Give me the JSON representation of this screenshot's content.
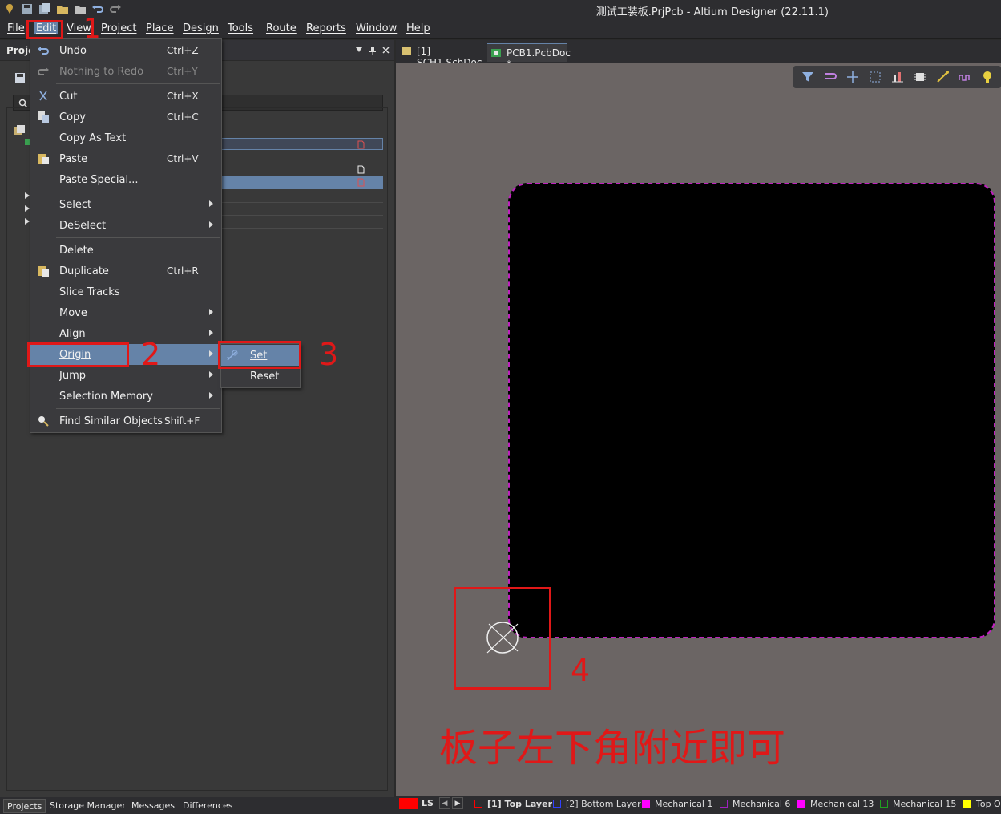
{
  "window": {
    "title": "测试工装板.PrjPcb - Altium Designer (22.11.1)"
  },
  "menubar": {
    "items": [
      {
        "label": "File"
      },
      {
        "label": "Edit"
      },
      {
        "label": "View"
      },
      {
        "label": "Project"
      },
      {
        "label": "Place"
      },
      {
        "label": "Design"
      },
      {
        "label": "Tools"
      },
      {
        "label": "Route"
      },
      {
        "label": "Reports"
      },
      {
        "label": "Window"
      },
      {
        "label": "Help"
      }
    ]
  },
  "left_panel": {
    "title": "Proje"
  },
  "doc_tabs": [
    {
      "label": "[1] SCH1.SchDoc"
    },
    {
      "label": "PCB1.PcbDoc *"
    }
  ],
  "edit_menu": {
    "items": [
      {
        "label": "Undo",
        "shortcut": "Ctrl+Z",
        "icon": "undo-icon"
      },
      {
        "label": "Nothing to Redo",
        "shortcut": "Ctrl+Y",
        "icon": "redo-icon",
        "disabled": true
      },
      {
        "label": "Cut",
        "shortcut": "Ctrl+X",
        "icon": "cut-icon"
      },
      {
        "label": "Copy",
        "shortcut": "Ctrl+C",
        "icon": "copy-icon"
      },
      {
        "label": "Copy As Text",
        "shortcut": ""
      },
      {
        "label": "Paste",
        "shortcut": "Ctrl+V",
        "icon": "paste-icon"
      },
      {
        "label": "Paste Special...",
        "shortcut": ""
      },
      {
        "label": "Select",
        "submenu": true
      },
      {
        "label": "DeSelect",
        "submenu": true
      },
      {
        "label": "Delete",
        "shortcut": ""
      },
      {
        "label": "Duplicate",
        "shortcut": "Ctrl+R",
        "icon": "duplicate-icon"
      },
      {
        "label": "Slice Tracks",
        "shortcut": ""
      },
      {
        "label": "Move",
        "submenu": true
      },
      {
        "label": "Align",
        "submenu": true
      },
      {
        "label": "Origin",
        "submenu": true,
        "highlighted": true
      },
      {
        "label": "Jump",
        "submenu": true
      },
      {
        "label": "Selection Memory",
        "submenu": true
      },
      {
        "label": "Find Similar Objects",
        "shortcut": "Shift+F",
        "icon": "find-icon"
      }
    ]
  },
  "origin_submenu": {
    "items": [
      {
        "label": "Set",
        "icon": "set-origin-icon",
        "highlighted": true
      },
      {
        "label": "Reset"
      }
    ]
  },
  "annotations": {
    "step1": "1",
    "step2": "2",
    "step3": "3",
    "step4": "4",
    "note": "板子左下角附近即可"
  },
  "layers": [
    {
      "label": "LS",
      "color": "#ff0000"
    },
    {
      "label": "[1] Top Layer",
      "color": "#ff0000"
    },
    {
      "label": "[2] Bottom Layer",
      "color": "#0000ff"
    },
    {
      "label": "Mechanical 1",
      "color": "#ff00ff"
    },
    {
      "label": "Mechanical 6",
      "color": "#800080"
    },
    {
      "label": "Mechanical 13",
      "color": "#ff00ff"
    },
    {
      "label": "Mechanical 15",
      "color": "#008000"
    },
    {
      "label": "Top O",
      "color": "#ffff00"
    }
  ],
  "bottom_tabs": [
    {
      "label": "Projects"
    },
    {
      "label": "Storage Manager"
    },
    {
      "label": "Messages"
    },
    {
      "label": "Differences"
    }
  ],
  "colors": {
    "annotation_red": "#e01818",
    "board_outline": "#c020c0",
    "menu_highlight": "#6583a8",
    "canvas": "#6b6564"
  }
}
